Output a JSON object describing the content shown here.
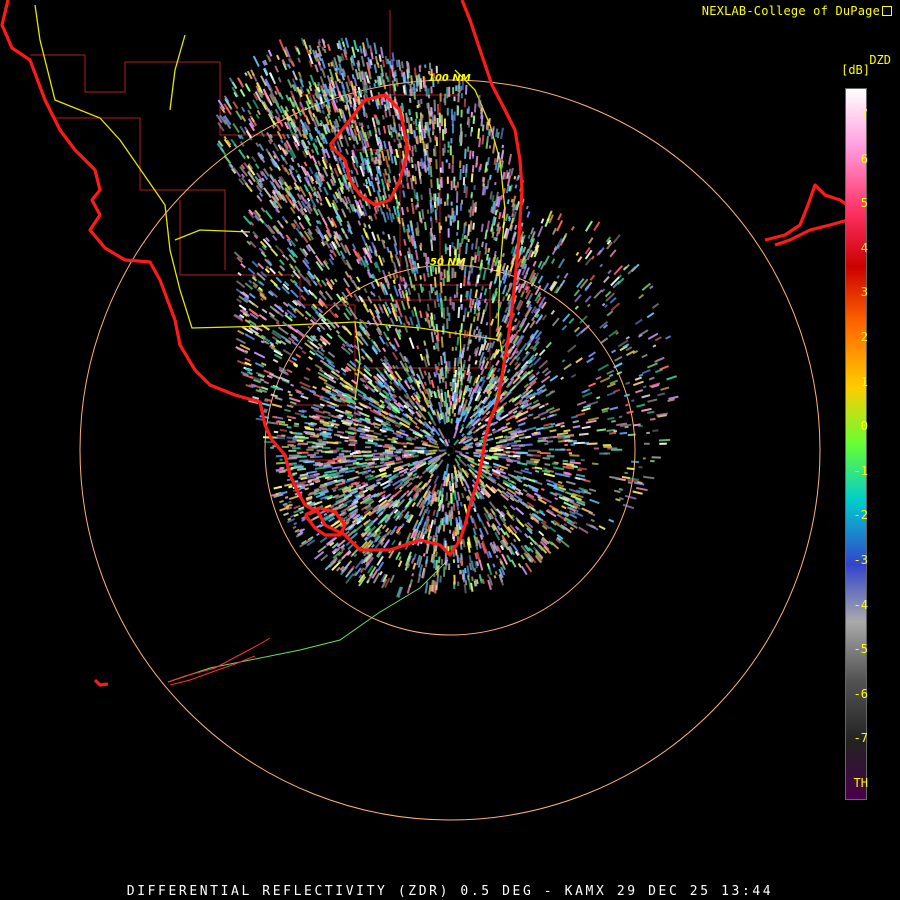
{
  "header": {
    "credit": "NEXLAB-College of DuPage",
    "external_link_icon": "external-link-icon"
  },
  "product_title": "DIFFERENTIAL REFLECTIVITY (ZDR) 0.5 DEG - KAMX 29 DEC 25 13:44",
  "range_rings": [
    {
      "label": "50 NM"
    },
    {
      "label": "100 NM"
    }
  ],
  "legend": {
    "product": "DZD",
    "unit": "[dB]",
    "ticks": [
      "7",
      "6",
      "5",
      "4",
      "3",
      "2",
      "1",
      "0",
      "-1",
      "-2",
      "-3",
      "-4",
      "-5",
      "-6",
      "-7",
      "TH"
    ],
    "colors": [
      "#ffffff",
      "#ff9ee0",
      "#ff3366",
      "#cc0000",
      "#ff6600",
      "#ffcc00",
      "#66ff33",
      "#00cccc",
      "#3344cc",
      "#aaaaaa",
      "#555555",
      "#222222",
      "#4a004a"
    ]
  },
  "map_colors": {
    "coastline": "#ff1a1a",
    "county_lines": "#cc2222",
    "highways": "#ffff00",
    "range_rings": "#ffb27a",
    "background": "#000000"
  }
}
